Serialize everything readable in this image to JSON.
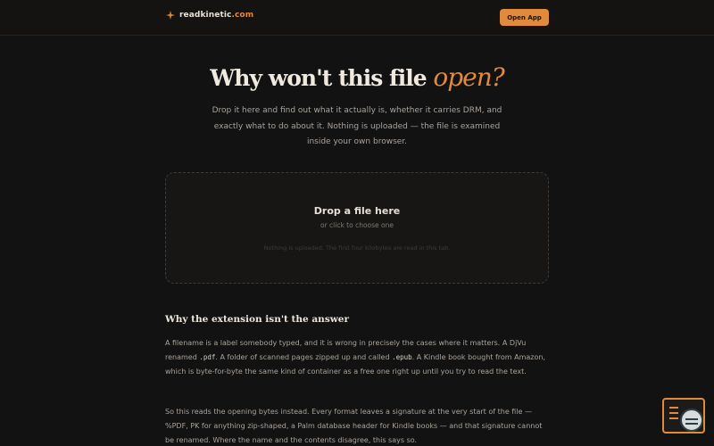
{
  "header": {
    "brand_name": "readkinetic",
    "brand_tld": ".com",
    "open_app_label": "Open App"
  },
  "hero": {
    "title_main": "Why won't this file ",
    "title_accent": "open?",
    "subtitle": "Drop it here and find out what it actually is, whether it carries DRM, and exactly what to do about it. Nothing is uploaded — the file is examined inside your own browser."
  },
  "drop_zone": {
    "title": "Drop a file here",
    "hint": "or click to choose one",
    "note": "Nothing is uploaded. The first four kilobytes are read in this tab."
  },
  "section": {
    "title": "Why the extension isn't the answer",
    "p1_a": "A filename is a label somebody typed, and it is wrong in precisely the cases where it matters. A DjVu renamed ",
    "p1_code1": ".pdf",
    "p1_b": ". A folder of scanned pages zipped up and called ",
    "p1_code2": ".epub",
    "p1_c": ". A Kindle book bought from Amazon, which is byte-for-byte the same kind of container as a free one right up until you try to read the text.",
    "p2": "So this reads the opening bytes instead. Every format leaves a signature at the very start of the file — %PDF, PK for anything zip-shaped, a Palm database header for Kindle books — and that signature cannot be renamed. Where the name and the contents disagree, this says so."
  },
  "colors": {
    "background": "#131212",
    "accent": "#e08a3c",
    "text": "#a9a39b"
  },
  "icons": {
    "brand": "spark-icon",
    "help": "help-widget-icon"
  }
}
